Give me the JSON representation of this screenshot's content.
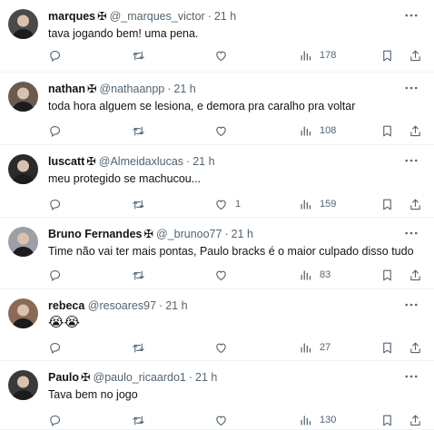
{
  "tweets": [
    {
      "name": "marques",
      "badge": "✠",
      "handle": "@_marques_victor",
      "time": "21 h",
      "text": "tava jogando bem! uma pena.",
      "replies": "",
      "reposts": "",
      "likes": "",
      "views": "178",
      "avatar_color": "#4a4a48"
    },
    {
      "name": "nathan",
      "badge": "✠",
      "handle": "@nathaanpp",
      "time": "21 h",
      "text": "toda hora alguem se lesiona, e demora pra caralho pra voltar",
      "replies": "",
      "reposts": "",
      "likes": "",
      "views": "108",
      "avatar_color": "#6b5a4e"
    },
    {
      "name": "luscatt",
      "badge": "✠",
      "handle": "@Almeidaxlucas",
      "time": "21 h",
      "text": "meu protegido se machucou...",
      "replies": "",
      "reposts": "",
      "likes": "1",
      "views": "159",
      "avatar_color": "#2b2b2b"
    },
    {
      "name": "Bruno Fernandes",
      "badge": "✠",
      "handle": "@_brunoo77",
      "time": "21 h",
      "text": "Time não vai ter mais pontas, Paulo bracks é o maior culpado disso tudo",
      "replies": "",
      "reposts": "",
      "likes": "",
      "views": "83",
      "avatar_color": "#9aa0a6"
    },
    {
      "name": "rebeca",
      "badge": "",
      "handle": "@resoares97",
      "time": "21 h",
      "text": "😭😭",
      "replies": "",
      "reposts": "",
      "likes": "",
      "views": "27",
      "avatar_color": "#8a6a55"
    },
    {
      "name": "Paulo",
      "badge": "✠",
      "handle": "@paulo_ricaardo1",
      "time": "21 h",
      "text": "Tava bem no jogo",
      "replies": "",
      "reposts": "",
      "likes": "",
      "views": "130",
      "avatar_color": "#3a3a3a"
    }
  ],
  "icons": {
    "reply": "reply-icon",
    "repost": "repost-icon",
    "like": "heart-icon",
    "views": "views-icon",
    "bookmark": "bookmark-icon",
    "share": "share-icon",
    "more": "more-icon"
  },
  "colors": {
    "text": "#0f1419",
    "secondary": "#536471",
    "divider": "#eff3f4"
  }
}
